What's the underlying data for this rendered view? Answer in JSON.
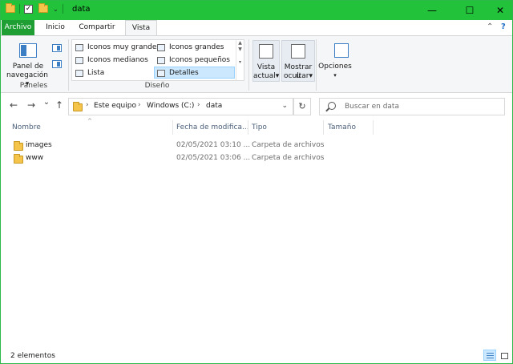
{
  "window": {
    "title": "data",
    "minimize_glyph": "—",
    "maximize_glyph": "☐",
    "close_glyph": "✕"
  },
  "ribbon_tabs": [
    {
      "label": "Archivo"
    },
    {
      "label": "Inicio"
    },
    {
      "label": "Compartir"
    },
    {
      "label": "Vista"
    }
  ],
  "ribbon_controls": {
    "collapse_glyph": "⌃",
    "help_glyph": "?"
  },
  "panes_group": {
    "navigation_pane_line1": "Panel de",
    "navigation_pane_line2": "navegación",
    "label": "Paneles"
  },
  "layout_group": {
    "items": [
      {
        "label": "Iconos muy grandes"
      },
      {
        "label": "Iconos grandes"
      },
      {
        "label": "Iconos medianos"
      },
      {
        "label": "Iconos pequeños"
      },
      {
        "label": "Lista"
      },
      {
        "label": "Detalles"
      }
    ],
    "label": "Diseño"
  },
  "view_buttons": {
    "current_view_line1": "Vista",
    "current_view_line2": "actual",
    "show_hide_line1": "Mostrar u",
    "show_hide_line2": "ocultar",
    "options": "Opciones"
  },
  "navigation": {
    "back_glyph": "←",
    "forward_glyph": "→",
    "recent_glyph": "⌄",
    "up_glyph": "↑",
    "breadcrumb": [
      "Este equipo",
      "Windows (C:)",
      "data"
    ],
    "crumb_separator": "›",
    "dropdown_glyph": "⌄",
    "refresh_glyph": "↻"
  },
  "search": {
    "placeholder": "Buscar en data"
  },
  "columns": [
    {
      "label": "Nombre"
    },
    {
      "label": "Fecha de modifica..."
    },
    {
      "label": "Tipo"
    },
    {
      "label": "Tamaño"
    }
  ],
  "sort_glyph": "^",
  "files": [
    {
      "name": "images",
      "date": "02/05/2021 03:10 ...",
      "type": "Carpeta de archivos"
    },
    {
      "name": "www",
      "date": "02/05/2021 03:06 ...",
      "type": "Carpeta de archivos"
    }
  ],
  "status": {
    "count": "2 elementos"
  },
  "colors": {
    "titlebar": "#22c33b",
    "file_tab": "#1e9e33",
    "selection": "#cce8ff",
    "accent": "#3b7ec4"
  }
}
